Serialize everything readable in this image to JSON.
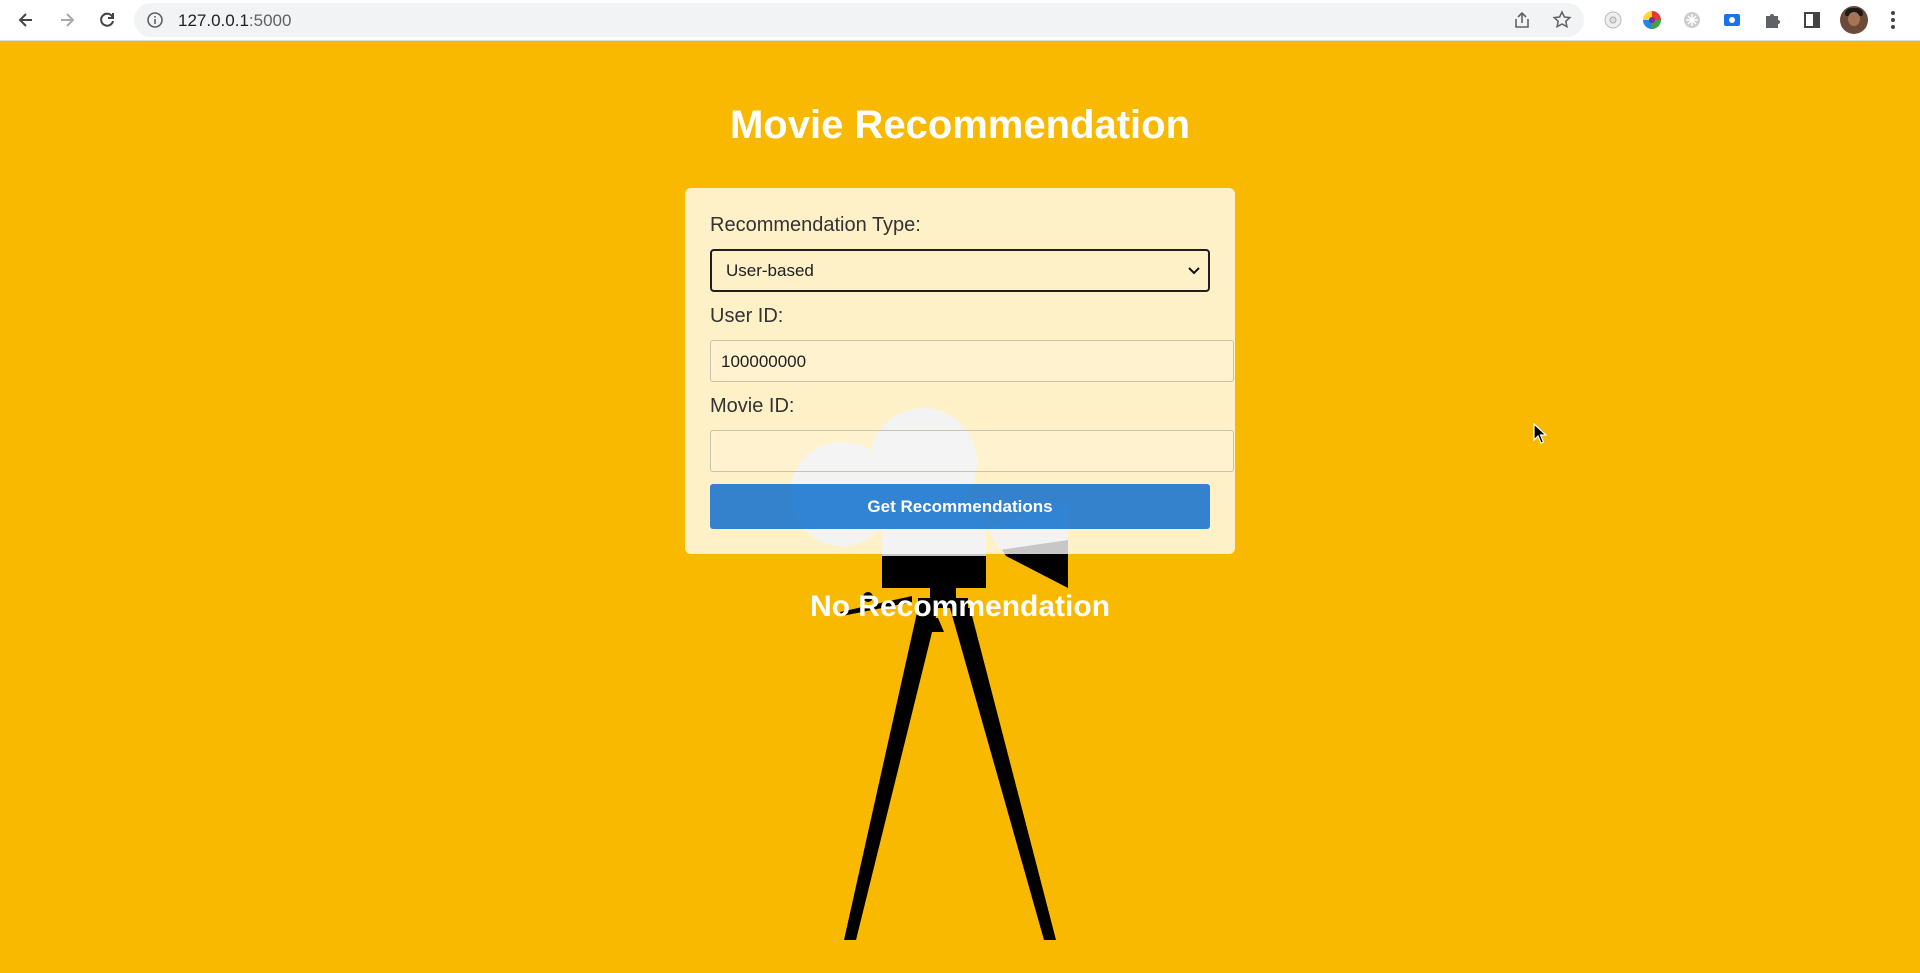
{
  "browser": {
    "url_host": "127.0.0.1",
    "url_port": ":5000",
    "icons": [
      "back-icon",
      "forward-icon",
      "reload-icon",
      "site-info-icon",
      "share-icon",
      "bookmark-star-icon",
      "extension-1-icon",
      "extension-2-icon",
      "extension-3-icon",
      "extension-4-icon",
      "puzzle-extensions-icon",
      "side-panel-icon",
      "profile-avatar",
      "more-menu-icon"
    ]
  },
  "page": {
    "title": "Movie Recommendation",
    "form": {
      "type_label": "Recommendation Type:",
      "type_selected": "User-based",
      "user_id_label": "User ID:",
      "user_id_value": "100000000",
      "movie_id_label": "Movie ID:",
      "movie_id_value": "",
      "submit_label": "Get Recommendations"
    },
    "result": "No Recommendation"
  },
  "colors": {
    "background": "#fab901",
    "title": "#ffffff",
    "card": "#fdecc2",
    "button": "#0066cc"
  }
}
